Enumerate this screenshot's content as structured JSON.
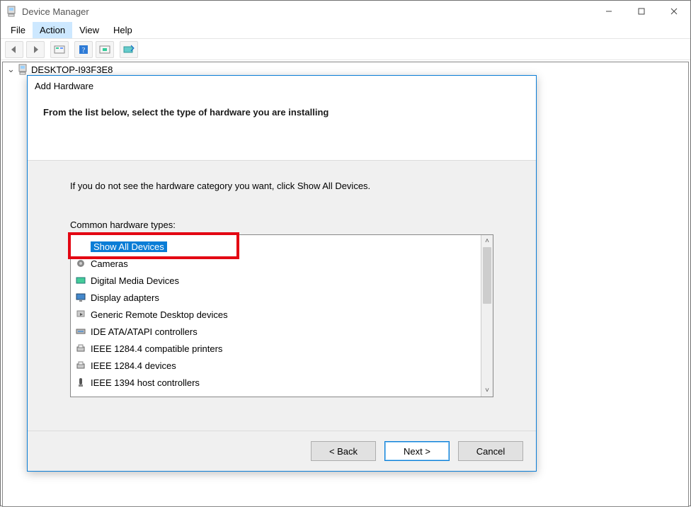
{
  "title": "Device Manager",
  "menubar": [
    "File",
    "Action",
    "View",
    "Help"
  ],
  "menubar_active_index": 1,
  "tree": {
    "root_label": "DESKTOP-I93F3E8"
  },
  "dialog": {
    "title": "Add Hardware",
    "heading": "From the list below, select the type of hardware you are installing",
    "info": "If you do not see the hardware category you want, click Show All Devices.",
    "list_label": "Common hardware types:",
    "items": [
      "Show All Devices",
      "Cameras",
      "Digital Media Devices",
      "Display adapters",
      "Generic Remote Desktop devices",
      "IDE ATA/ATAPI controllers",
      "IEEE 1284.4 compatible printers",
      "IEEE 1284.4 devices",
      "IEEE 1394 host controllers"
    ],
    "selected_index": 0,
    "buttons": {
      "back": "< Back",
      "next": "Next >",
      "cancel": "Cancel"
    }
  }
}
